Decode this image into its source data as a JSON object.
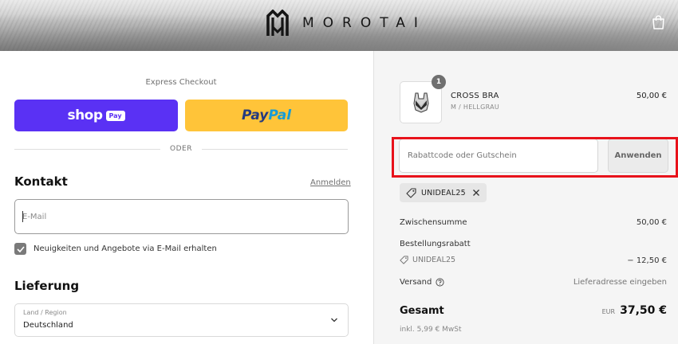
{
  "header": {
    "brand": "MOROTAI"
  },
  "express": {
    "label": "Express Checkout",
    "shop_word": "shop",
    "shop_pay": "Pay",
    "paypal_a": "Pay",
    "paypal_b": "Pal"
  },
  "divider": "ODER",
  "contact": {
    "title": "Kontakt",
    "login_link": "Anmelden",
    "email_placeholder": "E-Mail",
    "newsletter_label": "Neuigkeiten und Angebote via E-Mail erhalten",
    "newsletter_checked": true
  },
  "delivery": {
    "title": "Lieferung",
    "region_label": "Land / Region",
    "region_value": "Deutschland"
  },
  "cart": {
    "item": {
      "quantity": "1",
      "name": "CROSS BRA",
      "variant": "M / HELLGRAU",
      "price": "50,00 €"
    },
    "discount": {
      "placeholder": "Rabattcode oder Gutschein",
      "apply_label": "Anwenden",
      "applied_code": "UNIDEAL25"
    },
    "summary": {
      "subtotal_label": "Zwischensumme",
      "subtotal_value": "50,00 €",
      "order_discount_label": "Bestellungsrabatt",
      "discount_code": "UNIDEAL25",
      "discount_value": "− 12,50 €",
      "shipping_label": "Versand",
      "shipping_value": "Lieferadresse eingeben",
      "total_label": "Gesamt",
      "total_currency": "EUR",
      "total_value": "37,50 €",
      "tax_note": "inkl. 5,99 € MwSt"
    }
  },
  "colors": {
    "shop_pay": "#5a31f4",
    "paypal": "#ffc439",
    "highlight": "#e8121b"
  }
}
